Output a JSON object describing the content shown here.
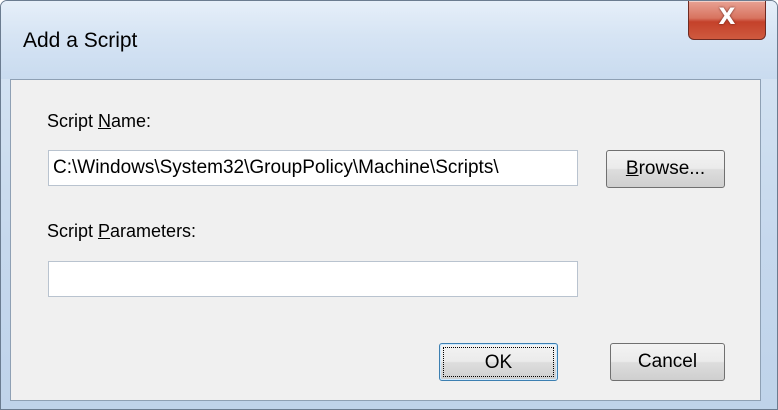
{
  "window": {
    "title": "Add a Script",
    "close_glyph": "X",
    "close_icon": "close-icon"
  },
  "form": {
    "script_name_label_prefix": "Script ",
    "script_name_label_accel": "N",
    "script_name_label_rest": "ame:",
    "script_name_value": "C:\\Windows\\System32\\GroupPolicy\\Machine\\Scripts\\",
    "script_params_label_prefix": "Script ",
    "script_params_label_accel": "P",
    "script_params_label_rest": "arameters:",
    "script_params_value": ""
  },
  "buttons": {
    "browse_accel": "B",
    "browse_rest": "rowse...",
    "ok_label": "OK",
    "cancel_label": "Cancel"
  },
  "colors": {
    "close_button": "#c4412a",
    "dialog_face": "#f0f0f0",
    "default_button_border": "#3c7fb1"
  }
}
